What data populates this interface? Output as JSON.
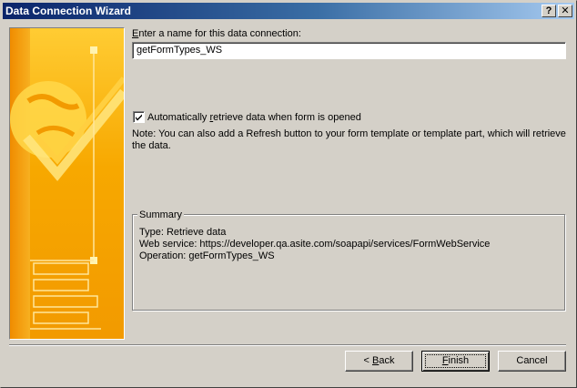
{
  "window": {
    "title": "Data Connection Wizard",
    "help_label": "?",
    "close_label": "✕"
  },
  "form": {
    "name_label_prefix": "",
    "name_label_accel": "E",
    "name_label_rest": "nter a name for this data connection:",
    "name_value": "getFormTypes_WS",
    "auto_checked": true,
    "auto_label_pre": "Automatically ",
    "auto_label_accel": "r",
    "auto_label_rest": "etrieve data when form is opened",
    "note": "Note: You can also add a Refresh button to your form template or template part, which will retrieve the data."
  },
  "summary": {
    "legend": "Summary",
    "type_line": "Type: Retrieve data",
    "service_line": "Web service: https://developer.qa.asite.com/soapapi/services/FormWebService",
    "operation_line": "Operation: getFormTypes_WS"
  },
  "buttons": {
    "back_prefix": "< ",
    "back_accel": "B",
    "back_rest": "ack",
    "finish_accel": "F",
    "finish_rest": "inish",
    "cancel": "Cancel"
  },
  "colors": {
    "title_bar_start": "#0a246a",
    "title_bar_end": "#a6caf0",
    "dialog_face": "#d4d0c8",
    "side_image_orange": "#f5a300",
    "side_image_yellow": "#ffd84a"
  },
  "icons": {
    "side_image": "decorative-wizard-banner",
    "check": "check-mark-icon"
  }
}
